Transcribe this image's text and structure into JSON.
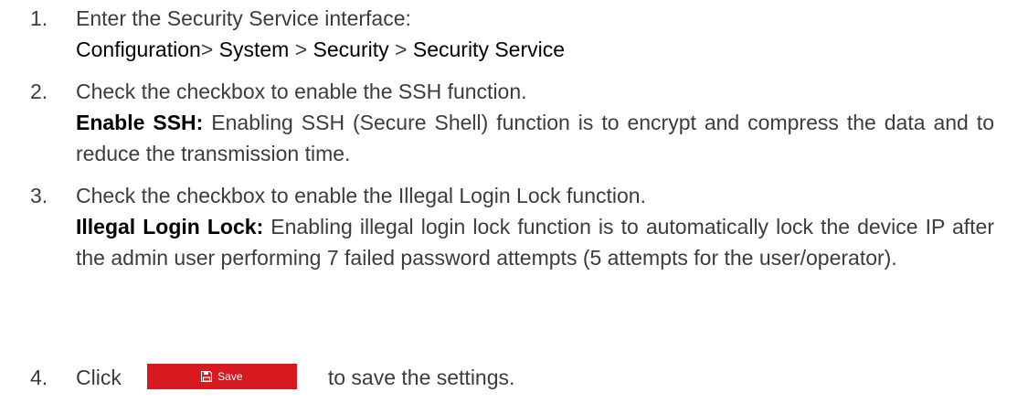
{
  "steps": [
    {
      "num": "1.",
      "text": "Enter the Security Service interface:",
      "path": [
        "Configuration",
        "> ",
        "System",
        " > ",
        "Security",
        " > ",
        "Security Service"
      ]
    },
    {
      "num": "2.",
      "text": "Check the checkbox to enable the SSH function.",
      "term": "Enable SSH:",
      "desc": " Enabling SSH (Secure Shell) function is to encrypt and compress the data and to reduce the transmission time."
    },
    {
      "num": "3.",
      "text": "Check the checkbox to enable the Illegal Login Lock function.",
      "term": "Illegal Login Lock:",
      "desc": " Enabling illegal login lock function is to automatically lock the device IP after the admin user performing 7 failed password attempts (5 attempts for the user/operator)."
    },
    {
      "num": "4.",
      "pre": "Click",
      "button_label": "Save",
      "button_icon": "floppy-disk-icon",
      "post": "to save the settings."
    }
  ],
  "colors": {
    "button_bg": "#d71920",
    "text": "#3c3c3c"
  }
}
